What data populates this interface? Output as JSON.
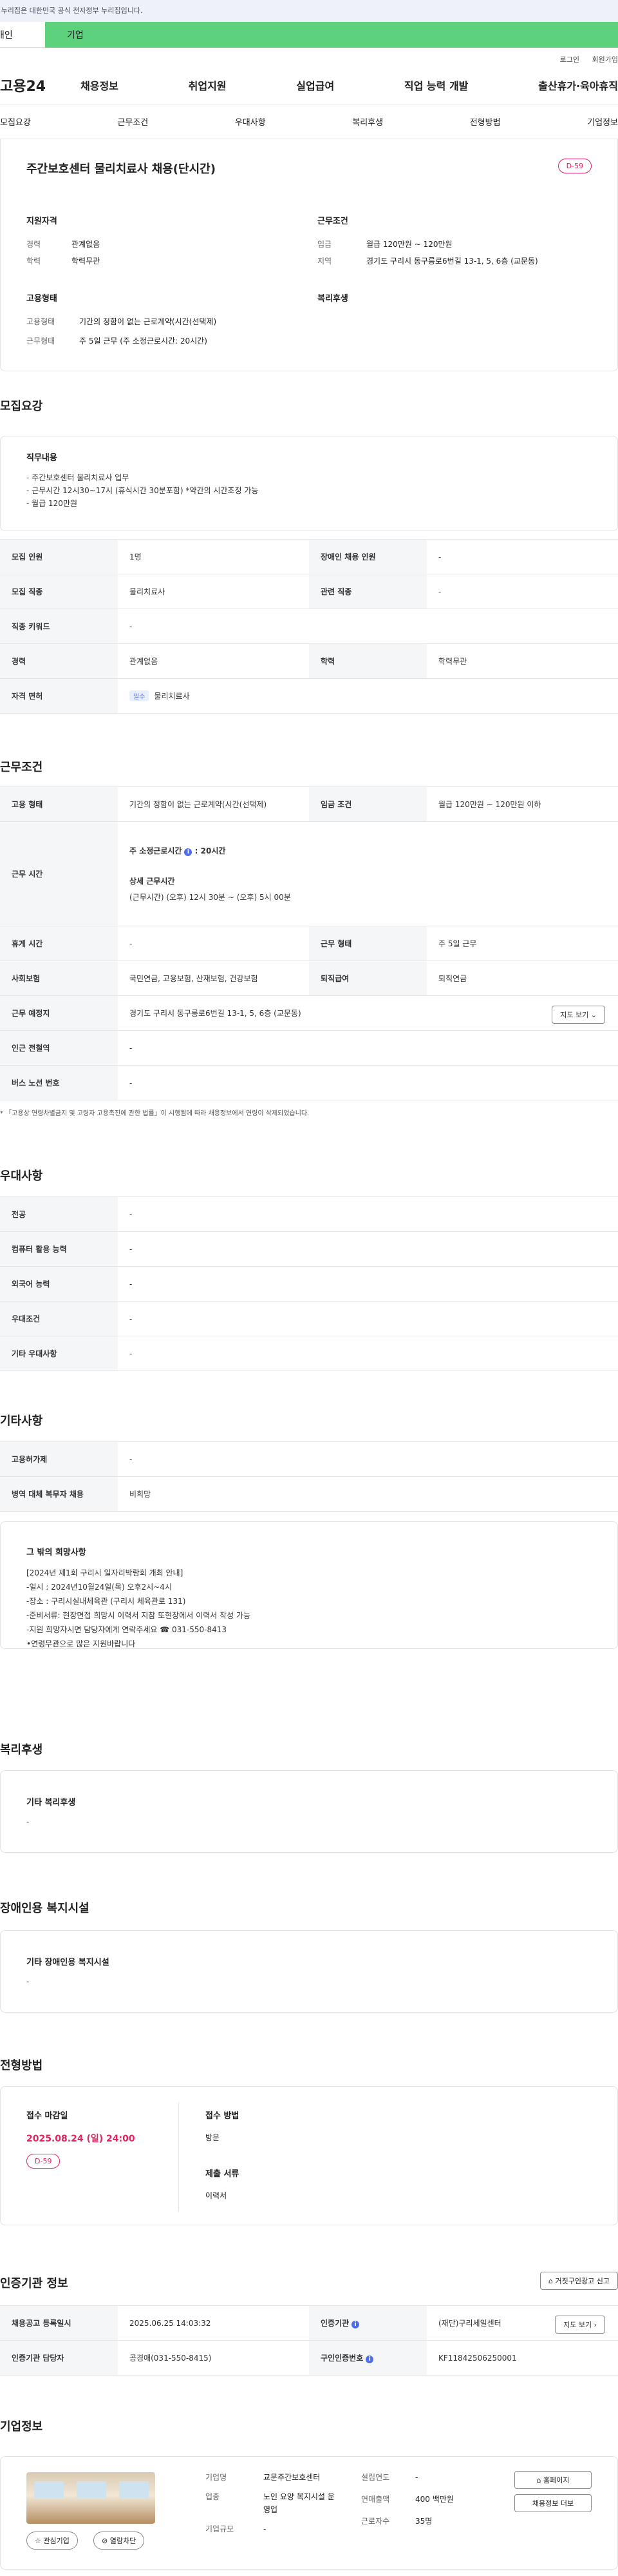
{
  "gov_banner": "이 누리집은 대한민국 공식 전자정부 누리집입니다.",
  "tabs": {
    "left": "개인",
    "right": "기업"
  },
  "util": {
    "login": "로그인",
    "join": "회원가입"
  },
  "gnb": {
    "logo": "고용24",
    "menu": [
      "채용정보",
      "취업지원",
      "실업급여",
      "직업 능력 개발",
      "출산휴가·육아휴직"
    ]
  },
  "subnav": [
    "모집요강",
    "근무조건",
    "우대사항",
    "복리후생",
    "전형방법",
    "기업정보"
  ],
  "job": {
    "title": "주간보호센터 물리치료사 채용(단시간)",
    "dday": "D-59",
    "qual_title": "지원자격",
    "qual": [
      {
        "k": "경력",
        "v": "관계없음"
      },
      {
        "k": "학력",
        "v": "학력무관"
      }
    ],
    "cond_title": "근무조건",
    "cond": [
      {
        "k": "임금",
        "v": "월급 120만원 ~ 120만원"
      },
      {
        "k": "지역",
        "v": "경기도 구리시 동구릉로6번길 13-1, 5, 6층 (교문동)"
      }
    ],
    "emp_title": "고용형태",
    "emp": [
      {
        "k": "고용형태",
        "v": "기간의 정함이 없는 근로계약(시간(선택제)"
      },
      {
        "k": "근무형태",
        "v": "주 5일 근무 (주 소정근로시간: 20시간)"
      }
    ],
    "welfare_title": "복리후생"
  },
  "recruit": {
    "title": "모집요강",
    "duty_title": "직무내용",
    "duty_lines": [
      "- 주간보호센터 물리치료사 업무",
      "- 근무시간 12시30~17시 (휴식시간 30분포함) *약간의 시간조정 가능",
      "- 월급 120만원"
    ],
    "rows": [
      [
        "모집 인원",
        "1명",
        "장애인 채용 인원",
        "-"
      ],
      [
        "모집 직종",
        "물리치료사",
        "관련 직종",
        "-"
      ],
      [
        "직종 키워드",
        "-"
      ],
      [
        "경력",
        "관계없음",
        "학력",
        "학력무관"
      ],
      [
        "자격 면허",
        "물리치료사"
      ]
    ],
    "req_badge": "필수"
  },
  "work": {
    "title": "근무조건",
    "emp_type_k": "고용 형태",
    "emp_type_v": "기간의 정함이 없는 근로계약(시간(선택제)",
    "wage_k": "임금 조건",
    "wage_v": "월급 120만원 ~ 120만원 이하",
    "hours_k": "근무 시간",
    "hours_weekly": "주 소정근로시간",
    "hours_weekly_v": "20시간",
    "hours_detail_title": "상세 근무시간",
    "hours_detail": "(근무시간) (오후) 12시 30분 ~ (오후) 5시 00분",
    "rest_k": "휴게 시간",
    "rest_v": "-",
    "form_k": "근무 형태",
    "form_v": "주 5일 근무",
    "ins_k": "사회보험",
    "ins_v": "국민연금, 고용보험, 산재보험, 건강보험",
    "ret_k": "퇴직급여",
    "ret_v": "퇴직연금",
    "place_k": "근무 예정지",
    "place_v": "경기도 구리시 동구릉로6번길 13-1, 5, 6층 (교문동)",
    "map_btn": "지도 보기",
    "subway_k": "인근 전철역",
    "subway_v": "-",
    "bus_k": "버스 노선 번호",
    "bus_v": "-",
    "note": "* 「고용상 연령차별금지 및 고령자 고용촉진에 관한 법률」이 시행됨에 따라 채용정보에서 연령이 삭제되었습니다."
  },
  "pref": {
    "title": "우대사항",
    "rows": [
      [
        "전공",
        "-"
      ],
      [
        "컴퓨터 활용 능력",
        "-"
      ],
      [
        "외국어 능력",
        "-"
      ],
      [
        "우대조건",
        "-"
      ],
      [
        "기타 우대사항",
        "-"
      ]
    ]
  },
  "etc": {
    "title": "기타사항",
    "rows": [
      [
        "고용허가제",
        "-"
      ],
      [
        "병역 대체 복무자 채용",
        "비희망"
      ]
    ],
    "box_title": "그 밖의 희망사항",
    "box_lines": [
      "[2024년 제1회 구리시 일자리박람회 개최 안내]",
      "-일시 : 2024년10월24일(목) 오후2시~4시",
      "-장소 : 구리시실내체육관 (구리시 체육관로 131)",
      "-준비서류: 현장면접 희망시 이력서 지참 또현장에서 이력서 작성 가능",
      "-지원 희망자시면 담당자에게 연락주세요 ☎ 031-550-8413",
      "•연령무관으로 많은 지원바랍니다"
    ]
  },
  "benefit": {
    "title": "복리후생",
    "box_title": "기타 복리후생",
    "box_val": "-"
  },
  "disabled": {
    "title": "장애인용 복지시설",
    "box_title": "기타 장애인용 복지시설",
    "box_val": "-"
  },
  "process": {
    "title": "전형방법",
    "deadline_k": "접수 마감일",
    "deadline_v": "2025.08.24 (일) 24:00",
    "dday": "D-59",
    "method_k": "접수 방법",
    "method_v": "방문",
    "docs_k": "제출 서류",
    "docs_v": "이력서"
  },
  "cert": {
    "title": "인증기관 정보",
    "report_btn": "거짓구인광고 신고",
    "rows": [
      [
        "채용공고 등록일시",
        "2025.06.25 14:03:32",
        "인증기관",
        "(재단)구리세일센터"
      ],
      [
        "인증기관 담당자",
        "공경애(031-550-8415)",
        "구인인증번호",
        "KF11842506250001"
      ]
    ],
    "map_btn": "지도 보기"
  },
  "company": {
    "title": "기업정보",
    "fav_btn": "관심기업",
    "block_btn": "열람차단",
    "items": [
      {
        "k": "기업명",
        "v": "교문주간보호센터"
      },
      {
        "k": "업종",
        "v": "노인 요양 복지시설 운영업"
      },
      {
        "k": "기업규모",
        "v": "-"
      }
    ],
    "items2": [
      {
        "k": "설립연도",
        "v": "-"
      },
      {
        "k": "연매출액",
        "v": "400 백만원"
      },
      {
        "k": "근로자수",
        "v": "35명"
      }
    ],
    "home_btn": "홈페이지",
    "more_btn": "채용정보 더보"
  }
}
